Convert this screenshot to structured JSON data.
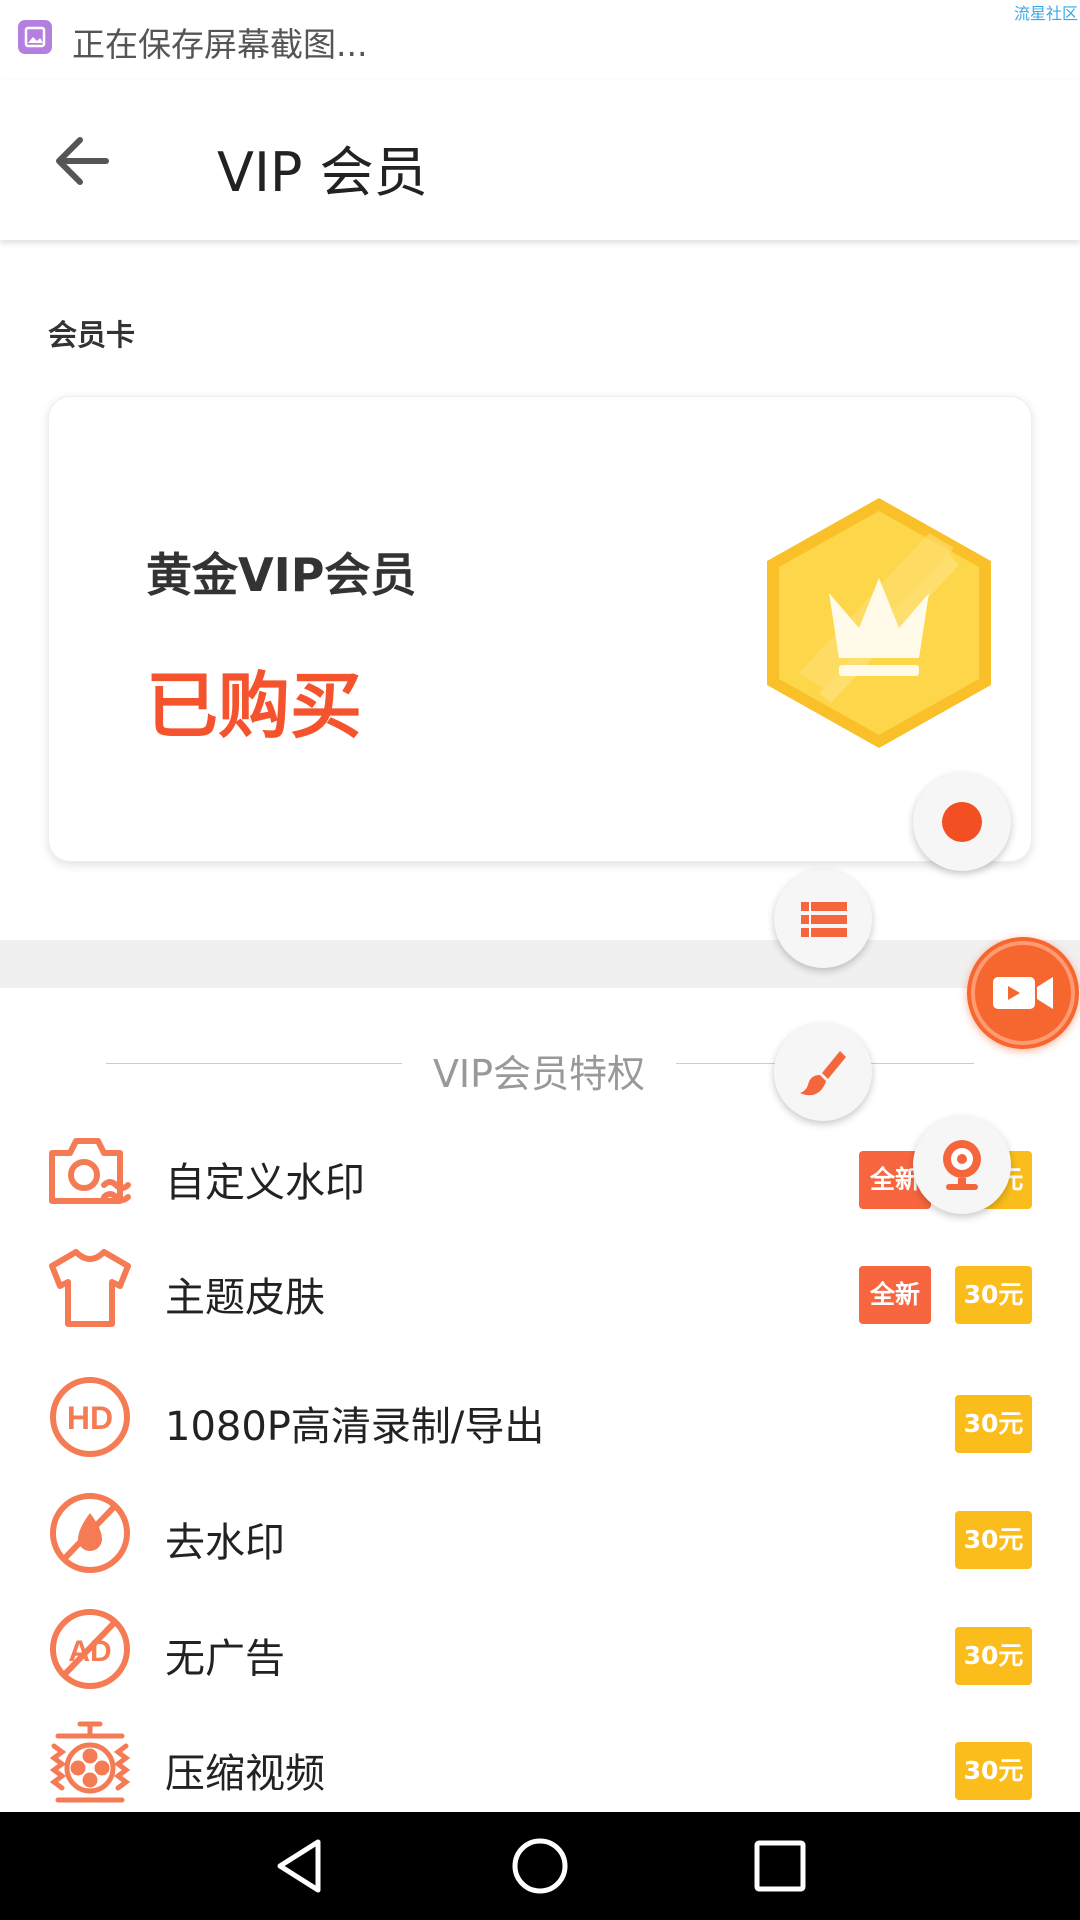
{
  "status_bar": {
    "text": "正在保存屏幕截图...",
    "watermark": "流星社区",
    "icon": "screenshot-icon"
  },
  "toolbar": {
    "title": "VIP 会员",
    "back_icon": "arrow-left-icon"
  },
  "member_section": {
    "label": "会员卡",
    "card": {
      "name": "黄金VIP会员",
      "status": "已购买",
      "badge_icon": "crown-icon"
    }
  },
  "privileges": {
    "heading": "VIP会员特权",
    "items": [
      {
        "label": "自定义水印",
        "icon": "camera-watermark-icon",
        "new_tag": "全新",
        "price": "30元"
      },
      {
        "label": "主题皮肤",
        "icon": "tshirt-icon",
        "new_tag": "全新",
        "price": "30元"
      },
      {
        "label": "1080P高清录制/导出",
        "icon": "hd-icon",
        "new_tag": "",
        "price": "30元"
      },
      {
        "label": "去水印",
        "icon": "no-watermark-icon",
        "new_tag": "",
        "price": "30元"
      },
      {
        "label": "无广告",
        "icon": "no-ad-icon",
        "new_tag": "",
        "price": "30元"
      },
      {
        "label": "压缩视频",
        "icon": "compress-video-icon",
        "new_tag": "",
        "price": "30元"
      }
    ]
  },
  "floating_menu": {
    "buttons": [
      "record-icon",
      "list-icon",
      "brush-icon",
      "webcam-icon",
      "video-camera-icon"
    ]
  },
  "nav_bar": {
    "buttons": [
      "nav-back-icon",
      "nav-home-icon",
      "nav-recent-icon"
    ]
  },
  "colors": {
    "accent": "#f5532d",
    "new_tag": "#f7663f",
    "price_tag": "#fbbd1b",
    "icon_orange": "#f57b55",
    "gold": "#fbc62e"
  }
}
